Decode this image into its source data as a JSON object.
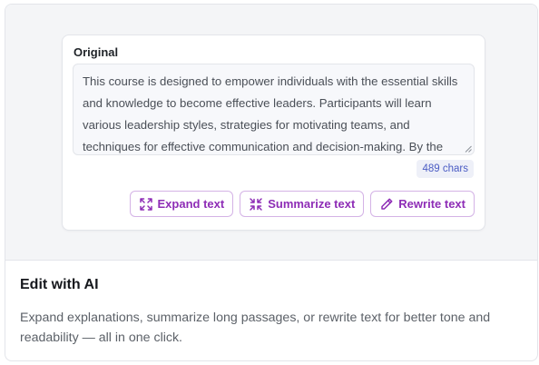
{
  "panel": {
    "label": "Original",
    "text": "This course is designed to empower individuals with the essential skills and knowledge to become effective leaders. Participants will learn various leadership styles, strategies for motivating teams, and techniques for effective communication and decision-making. By the",
    "char_count": "489 chars"
  },
  "actions": [
    {
      "label": "Expand text",
      "icon": "expand-icon"
    },
    {
      "label": "Summarize text",
      "icon": "collapse-icon"
    },
    {
      "label": "Rewrite text",
      "icon": "pencil-icon"
    }
  ],
  "info": {
    "title": "Edit with AI",
    "description": "Expand explanations, summarize long passages, or rewrite text for better tone and readability — all in one click."
  },
  "colors": {
    "accent": "#8e2db6",
    "accent_border": "#d4b3e6",
    "badge_text": "#4b5cc4",
    "badge_bg": "#eef0f8"
  }
}
